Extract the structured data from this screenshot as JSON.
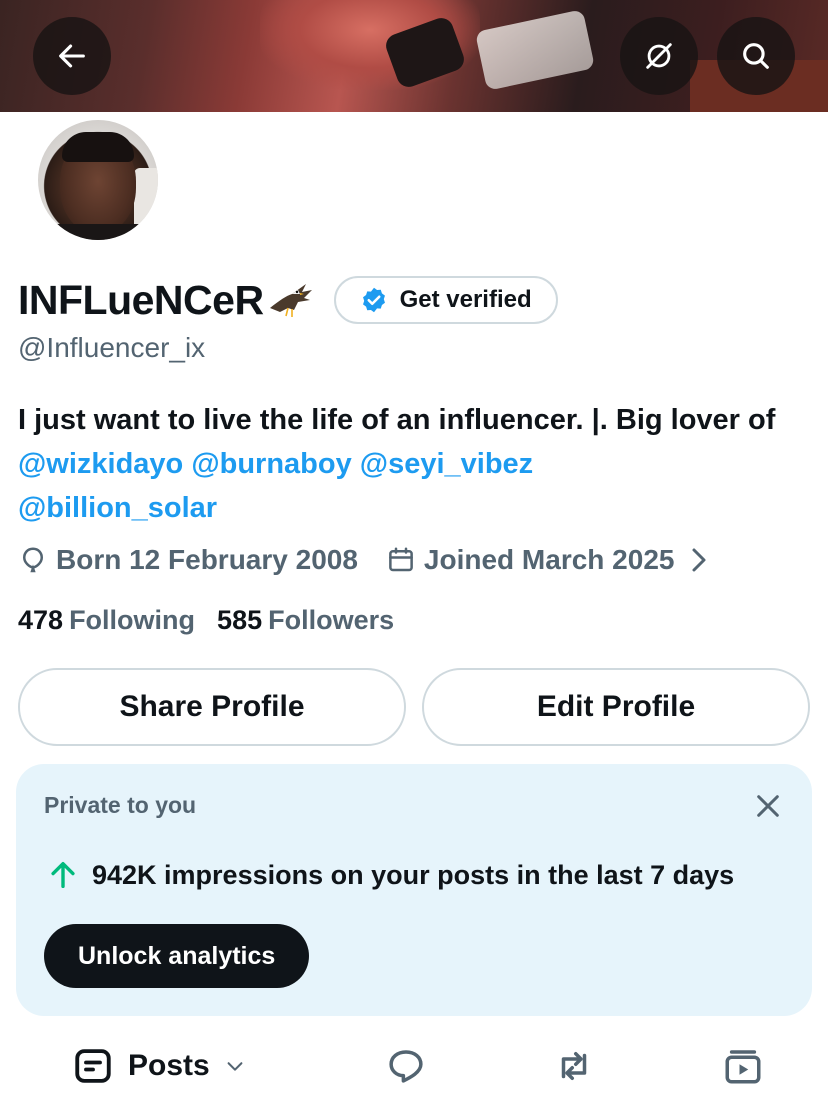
{
  "header": {
    "back_icon": "arrow-left-icon",
    "hide_icon": "eye-off-icon",
    "search_icon": "search-icon"
  },
  "profile": {
    "display_name": "INFLueNCeR",
    "name_emoji": "eagle-icon",
    "verify_label": "Get verified",
    "handle": "@Influencer_ix",
    "bio": {
      "text1": "I just want to live the life of an influencer. |. Big lover of ",
      "mentions": [
        "@wizkidayo",
        "@burnaboy",
        "@seyi_vibez",
        "@billion_solar"
      ]
    },
    "born": "Born 12 February 2008",
    "joined": "Joined March 2025",
    "following_count": "478",
    "following_label": "Following",
    "followers_count": "585",
    "followers_label": "Followers"
  },
  "actions": {
    "share_label": "Share Profile",
    "edit_label": "Edit Profile"
  },
  "private_card": {
    "label": "Private to you",
    "impressions": "942K impressions on your posts in the last 7 days",
    "button": "Unlock analytics"
  },
  "tabs": {
    "posts_label": "Posts"
  },
  "colors": {
    "accent": "#1d9bf0",
    "muted_text": "#536471",
    "card_bg": "#e6f4fb",
    "up_arrow": "#00ba7c"
  }
}
